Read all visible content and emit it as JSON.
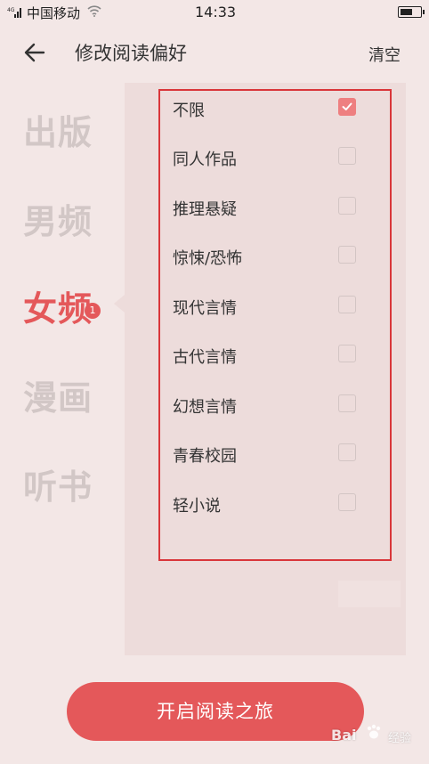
{
  "status_bar": {
    "carrier": "中国移动",
    "time": "14:33",
    "signal_label": "4G",
    "battery_level": 0.6
  },
  "header": {
    "back_icon": "arrow-left-icon",
    "title": "修改阅读偏好",
    "clear_label": "清空"
  },
  "categories": [
    {
      "label": "出版",
      "active": false
    },
    {
      "label": "男频",
      "active": false
    },
    {
      "label": "女频",
      "active": true,
      "badge": "1"
    },
    {
      "label": "漫画",
      "active": false
    },
    {
      "label": "听书",
      "active": false
    }
  ],
  "options": [
    {
      "label": "不限",
      "checked": true
    },
    {
      "label": "同人作品",
      "checked": false
    },
    {
      "label": "推理悬疑",
      "checked": false
    },
    {
      "label": "惊悚/恐怖",
      "checked": false
    },
    {
      "label": "现代言情",
      "checked": false
    },
    {
      "label": "古代言情",
      "checked": false
    },
    {
      "label": "幻想言情",
      "checked": false
    },
    {
      "label": "青春校园",
      "checked": false
    },
    {
      "label": "轻小说",
      "checked": false
    }
  ],
  "start_button_label": "开启阅读之旅",
  "watermark": {
    "brand": "Bai",
    "sub": "经验"
  },
  "colors": {
    "accent": "#e4585a",
    "check_fill": "#ee7f80",
    "highlight_border": "#d9363a",
    "background": "#f3e7e6",
    "panel": "#eddcdb"
  }
}
